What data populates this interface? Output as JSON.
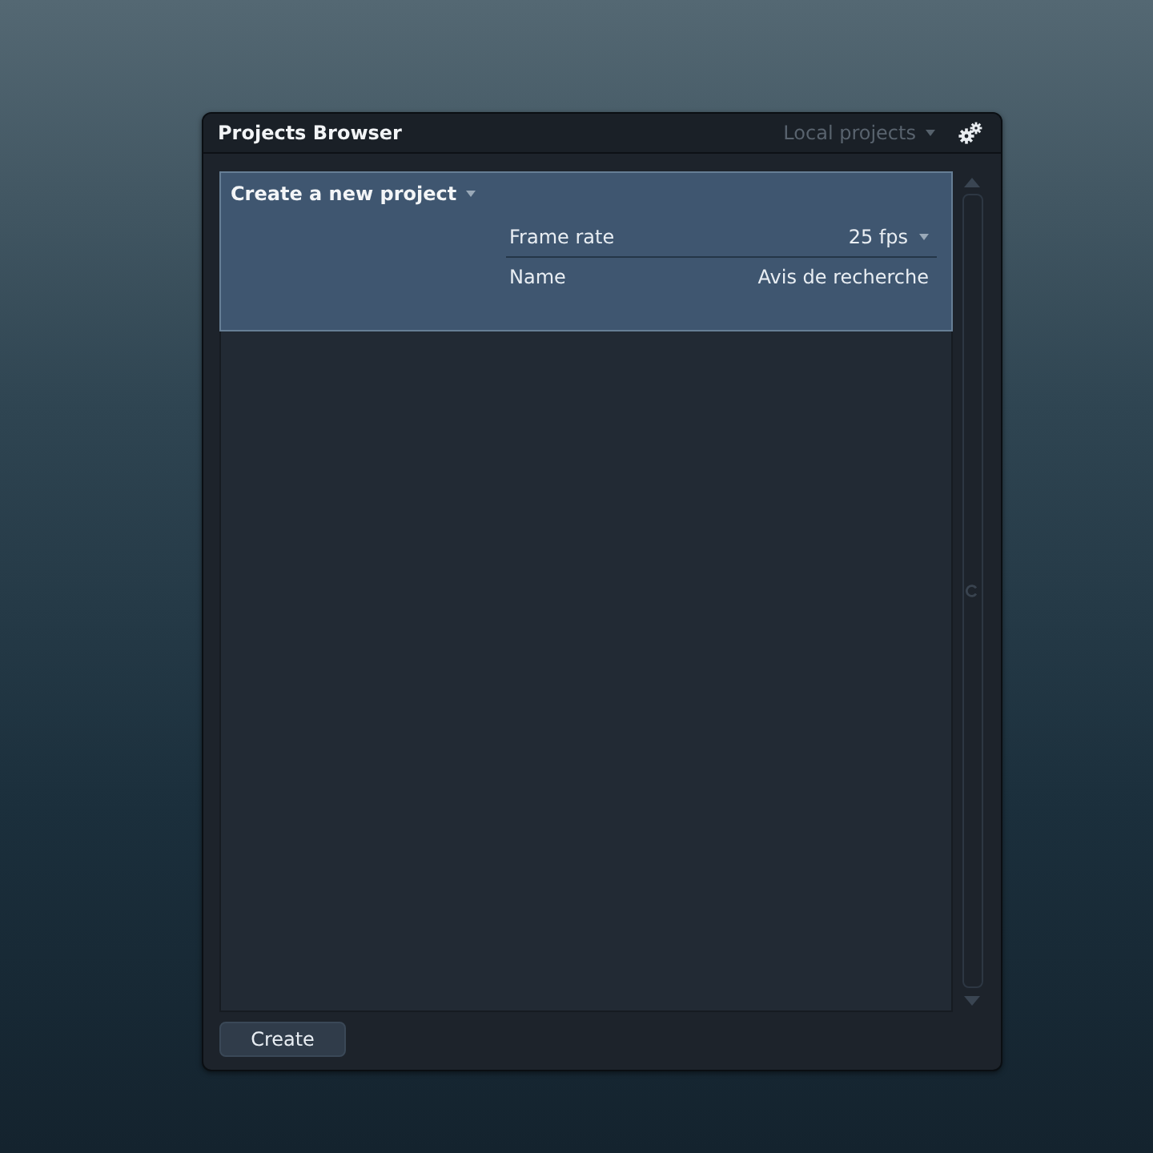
{
  "window": {
    "title": "Projects Browser"
  },
  "source_menu": {
    "label": "Local projects"
  },
  "new_project": {
    "title": "Create a new project",
    "expanded": true,
    "fields": [
      {
        "kind": "dropdown",
        "label": "Frame rate",
        "value": "25 fps"
      },
      {
        "kind": "text",
        "label": "Name",
        "value": "Avis de recherche"
      }
    ]
  },
  "buttons": [
    {
      "label": "Create"
    }
  ]
}
